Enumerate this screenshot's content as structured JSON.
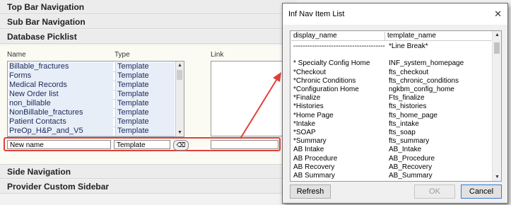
{
  "sections": {
    "top_bar": "Top Bar Navigation",
    "sub_bar": "Sub Bar Navigation",
    "picklist": "Database Picklist",
    "side": "Side Navigation",
    "provider": "Provider Custom Sidebar"
  },
  "columns": {
    "name": "Name",
    "type": "Type",
    "link": "Link"
  },
  "picklist_rows": [
    {
      "name": "Billable_fractures",
      "type": "Template"
    },
    {
      "name": "Forms",
      "type": "Template"
    },
    {
      "name": "Medical Records",
      "type": "Template"
    },
    {
      "name": "New Order list",
      "type": "Template"
    },
    {
      "name": "non_billable",
      "type": "Template"
    },
    {
      "name": "NonBillable_fractures",
      "type": "Template"
    },
    {
      "name": "Patient Contacts",
      "type": "Template"
    },
    {
      "name": "PreOp_H&P_and_V5",
      "type": "Template"
    }
  ],
  "new_row": {
    "name_value": "New name",
    "type_value": "Template",
    "link_value": ""
  },
  "annotation_color": "#e0403a",
  "dialog": {
    "title": "Inf Nav Item List",
    "close_glyph": "✕",
    "headers": {
      "col1": "display_name",
      "col2": "template_name"
    },
    "rows": [
      {
        "d": "---------------------------------------",
        "t": "*Line Break*"
      },
      {
        "d": "",
        "t": ""
      },
      {
        "d": "* Specialty Config Home",
        "t": "INF_system_homepage"
      },
      {
        "d": "*Checkout",
        "t": "fts_checkout"
      },
      {
        "d": "*Chronic Conditions",
        "t": "fts_chronic_conditions"
      },
      {
        "d": "*Configuration Home",
        "t": "ngkbm_config_home"
      },
      {
        "d": "*Finalize",
        "t": "Fts_finalize"
      },
      {
        "d": "*Histories",
        "t": "fts_histories"
      },
      {
        "d": "*Home Page",
        "t": "fts_home_page"
      },
      {
        "d": "*Intake",
        "t": "fts_intake"
      },
      {
        "d": "*SOAP",
        "t": "fts_soap"
      },
      {
        "d": "*Summary",
        "t": "fts_summary"
      },
      {
        "d": "AB Intake",
        "t": "AB_Intake"
      },
      {
        "d": "AB Procedure",
        "t": "AB_Procedure"
      },
      {
        "d": "AB Recovery",
        "t": "AB_Recovery"
      },
      {
        "d": "AB Summary",
        "t": "AB_Summary"
      }
    ],
    "buttons": {
      "refresh": "Refresh",
      "ok": "OK",
      "cancel": "Cancel"
    }
  }
}
